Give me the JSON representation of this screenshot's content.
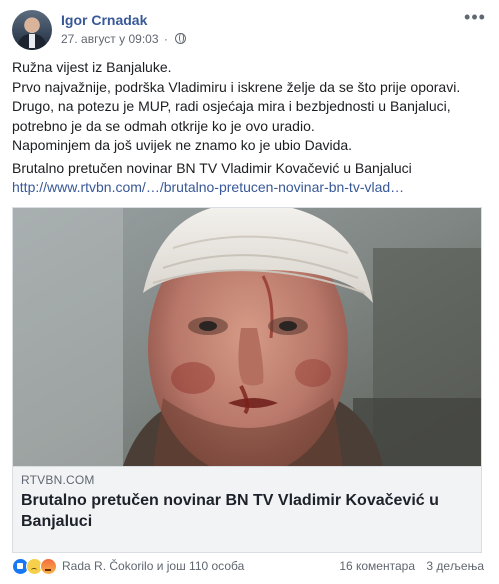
{
  "post": {
    "author": "Igor Crnadak",
    "timestamp": "27. август у 09:03",
    "separator": "·",
    "privacy_icon": "globe-icon",
    "menu_icon": "more-options-icon",
    "text_lines": [
      "Ružna vijest iz Banjaluke.",
      "Prvo najvažnije, podrška Vladimiru i iskrene želje da se što prije oporavi.",
      "Drugo, na potezu je MUP, radi osjećaja mira i bezbjednosti u Banjaluci,",
      "potrebno je da se odmah otkrije ko je ovo uradio.",
      "Napominjem da još uvijek ne znamo ko je ubio Davida."
    ],
    "shared_headline": "Brutalno pretučen novinar BN TV Vladimir Kovačević u Banjaluci",
    "shared_url": "http://www.rtvbn.com/…/brutalno-pretucen-novinar-bn-tv-vlad…"
  },
  "link_card": {
    "domain": "RTVBN.COM",
    "title": "Brutalno pretučen novinar BN TV Vladimir Kovačević u Banjaluci"
  },
  "footer": {
    "reactions_text": "Rada R. Čokorilo и још 110 особа",
    "comments": "16 коментара",
    "shares": "3 дељења"
  },
  "colors": {
    "link": "#385898",
    "text": "#1c1e21",
    "meta": "#616770",
    "card_bg": "#f2f3f5"
  }
}
